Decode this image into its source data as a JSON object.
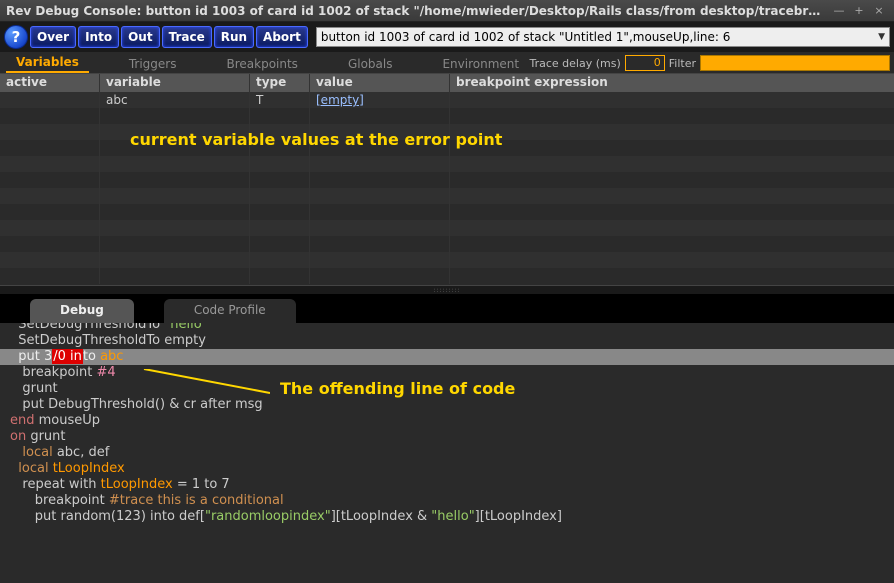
{
  "window": {
    "title": "Rev Debug Console: button id 1003 of card id 1002 of stack \"/home/mwieder/Desktop/Rails class/from desktop/tracebre...",
    "min": "—",
    "max": "+",
    "close": "×"
  },
  "toolbar": {
    "help": "?",
    "buttons": [
      "Over",
      "Into",
      "Out",
      "Trace",
      "Run",
      "Abort"
    ],
    "context": "button id 1003 of card id 1002 of stack \"Untitled 1\",mouseUp,line: 6"
  },
  "tabs": {
    "items": [
      "Variables",
      "Triggers",
      "Breakpoints",
      "Globals",
      "Environment"
    ],
    "active": 0
  },
  "filter": {
    "delay_label": "Trace delay (ms)",
    "delay_value": "0",
    "filter_label": "Filter"
  },
  "var_table": {
    "headers": {
      "active": "active",
      "variable": "variable",
      "type": "type",
      "value": "value",
      "bp": "breakpoint expression"
    },
    "rows": [
      {
        "active": "",
        "variable": "abc",
        "type": "T",
        "value": "[empty]",
        "bp": ""
      }
    ]
  },
  "callouts": {
    "vars": "current variable values at the error point",
    "code": "The offending line of code"
  },
  "lower_tabs": {
    "debug": "Debug",
    "profile": "Code Profile"
  },
  "code": {
    "l0": "  SetDebugThresholdTo \"hello\"",
    "l1": "  SetDebugThresholdTo empty",
    "l2a": "  put 3",
    "l2b": "/0 in",
    "l2c": "to ",
    "l2d": "abc",
    "l3a": "   breakpoint ",
    "l3b": "#4",
    "l4": "   grunt",
    "l5": "   put DebugThreshold() & cr after msg",
    "l6a": "end",
    "l6b": " mouseUp",
    "l7": "",
    "l8a": "on",
    "l8b": " grunt",
    "l9a": "   local",
    "l9b": " abc, def",
    "l10a": "  local",
    "l10b": " tLoopIndex",
    "l11": "",
    "l12a": "   repeat with ",
    "l12b": "tLoopIndex",
    "l12c": " = 1 to 7",
    "l13a": "      breakpoint ",
    "l13b": "#trace this is a conditional",
    "l14a": "      put random(123) into def[",
    "l14b": "\"randomloopindex\"",
    "l14c": "][tLoopIndex & ",
    "l14d": "\"hello\"",
    "l14e": "][tLoopIndex]"
  }
}
